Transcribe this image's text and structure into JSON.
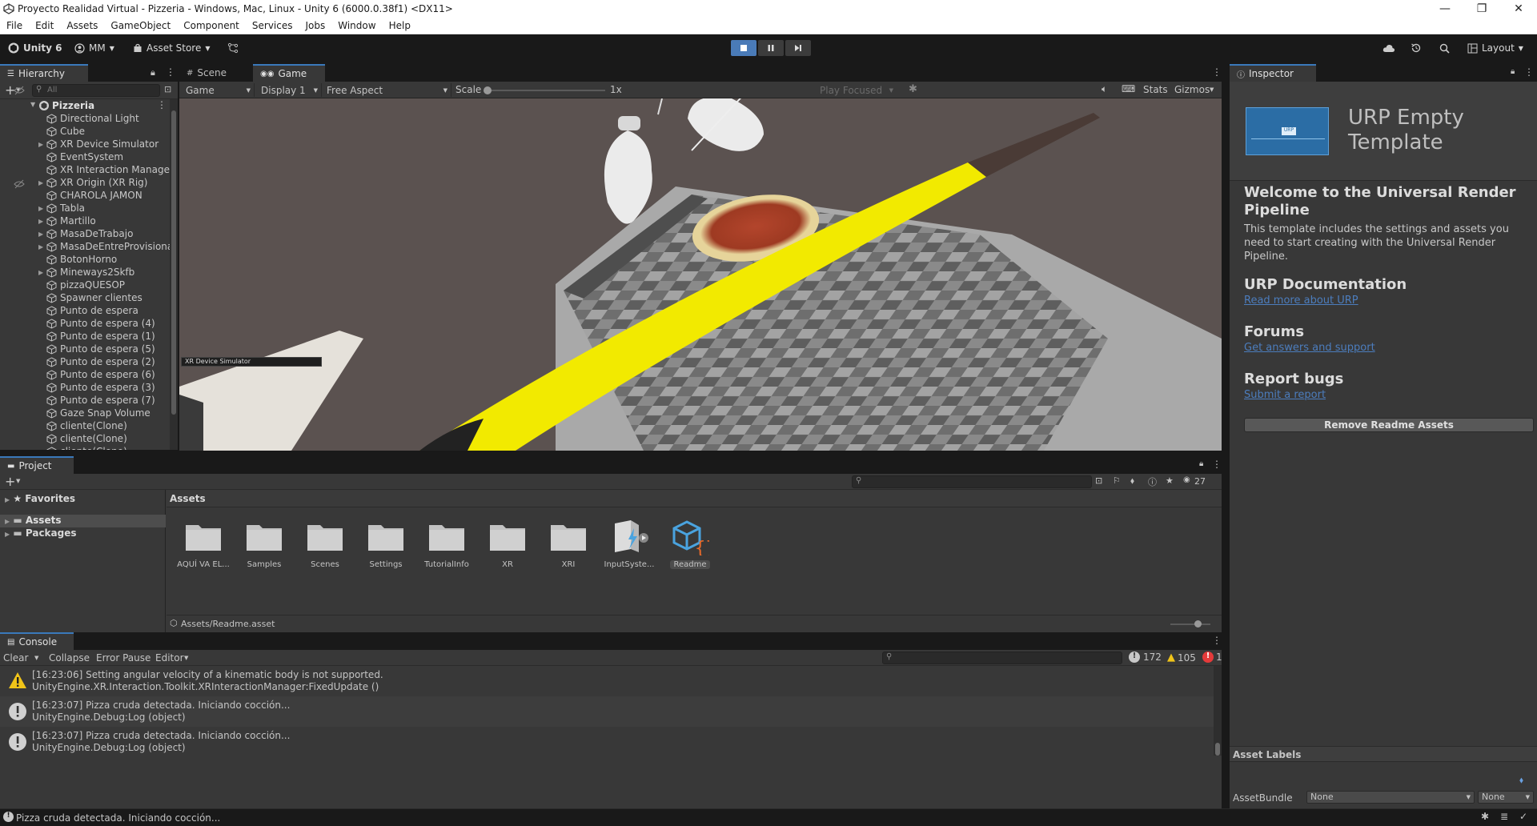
{
  "window": {
    "title": "Proyecto Realidad Virtual - Pizzeria - Windows, Mac, Linux - Unity 6 (6000.0.38f1) <DX11>",
    "minimize": "—",
    "maximize": "❐",
    "close": "✕"
  },
  "menu": [
    "File",
    "Edit",
    "Assets",
    "GameObject",
    "Component",
    "Services",
    "Jobs",
    "Window",
    "Help"
  ],
  "toolbar": {
    "unity_label": "Unity 6",
    "account_label": "MM",
    "asset_store_label": "Asset Store",
    "layout_label": "Layout"
  },
  "hierarchy": {
    "tab_label": "Hierarchy",
    "search_placeholder": "All",
    "scene_name": "Pizzeria",
    "items": [
      {
        "label": "Directional Light",
        "foldable": false
      },
      {
        "label": "Cube",
        "foldable": false
      },
      {
        "label": "XR Device Simulator",
        "foldable": true
      },
      {
        "label": "EventSystem",
        "foldable": false
      },
      {
        "label": "XR Interaction Manager",
        "foldable": false
      },
      {
        "label": "XR Origin (XR Rig)",
        "foldable": true
      },
      {
        "label": "CHAROLA JAMON",
        "foldable": false
      },
      {
        "label": "Tabla",
        "foldable": true
      },
      {
        "label": "Martillo",
        "foldable": true
      },
      {
        "label": "MasaDeTrabajo",
        "foldable": true
      },
      {
        "label": "MasaDeEntreProvisional",
        "foldable": true
      },
      {
        "label": "BotonHorno",
        "foldable": false
      },
      {
        "label": "Mineways2Skfb",
        "foldable": true
      },
      {
        "label": "pizzaQUESOP",
        "foldable": false
      },
      {
        "label": "Spawner clientes",
        "foldable": false
      },
      {
        "label": "Punto de espera",
        "foldable": false
      },
      {
        "label": "Punto de espera (4)",
        "foldable": false
      },
      {
        "label": "Punto de espera (1)",
        "foldable": false
      },
      {
        "label": "Punto de espera (5)",
        "foldable": false
      },
      {
        "label": "Punto de espera (2)",
        "foldable": false
      },
      {
        "label": "Punto de espera (6)",
        "foldable": false
      },
      {
        "label": "Punto de espera (3)",
        "foldable": false
      },
      {
        "label": "Punto de espera (7)",
        "foldable": false
      },
      {
        "label": "Gaze Snap Volume",
        "foldable": false
      },
      {
        "label": "cliente(Clone)",
        "foldable": false
      },
      {
        "label": "cliente(Clone)",
        "foldable": false
      },
      {
        "label": "cliente(Clone)",
        "foldable": false
      }
    ]
  },
  "game_view": {
    "tabs": [
      "Scene",
      "Game"
    ],
    "game_dropdown": "Game",
    "display_dropdown": "Display 1",
    "aspect_dropdown": "Free Aspect",
    "scale_label": "Scale",
    "scale_value": "1x",
    "play_focused": "Play Focused",
    "stats_label": "Stats",
    "gizmos_label": "Gizmos",
    "overlay_label": "XR Device Simulator"
  },
  "project": {
    "tab_label": "Project",
    "badge_count": "27",
    "favorites_label": "Favorites",
    "tree": [
      "Assets",
      "Packages"
    ],
    "breadcrumb": "Assets",
    "assets": [
      {
        "label": "AQUÍ VA EL...",
        "kind": "folder"
      },
      {
        "label": "Samples",
        "kind": "folder"
      },
      {
        "label": "Scenes",
        "kind": "folder"
      },
      {
        "label": "Settings",
        "kind": "folder"
      },
      {
        "label": "TutorialInfo",
        "kind": "folder"
      },
      {
        "label": "XR",
        "kind": "folder"
      },
      {
        "label": "XRI",
        "kind": "folder"
      },
      {
        "label": "InputSyste...",
        "kind": "input-actions"
      },
      {
        "label": "Readme",
        "kind": "readme"
      }
    ],
    "status_path": "Assets/Readme.asset"
  },
  "console": {
    "tab_label": "Console",
    "clear_label": "Clear",
    "collapse_label": "Collapse",
    "error_pause_label": "Error Pause",
    "editor_label": "Editor",
    "info_count": "172",
    "warning_count": "105",
    "error_count": "1",
    "logs": [
      {
        "type": "warning",
        "line1": "[16:23:06] Setting angular velocity of a kinematic body is not supported.",
        "line2": "UnityEngine.XR.Interaction.Toolkit.XRInteractionManager:FixedUpdate ()"
      },
      {
        "type": "info",
        "line1": "[16:23:07] Pizza cruda detectada. Iniciando cocción...",
        "line2": "UnityEngine.Debug:Log (object)"
      },
      {
        "type": "info",
        "line1": "[16:23:07] Pizza cruda detectada. Iniciando cocción...",
        "line2": "UnityEngine.Debug:Log (object)"
      }
    ]
  },
  "inspector": {
    "tab_label": "Inspector",
    "template_title": "URP Empty Template",
    "thumb_label": "URP",
    "welcome_heading": "Welcome to the Universal Render Pipeline",
    "welcome_text": "This template includes the settings and assets you need to start creating with the Universal Render Pipeline.",
    "doc_heading": "URP Documentation",
    "doc_link": "Read more about URP",
    "forums_heading": "Forums",
    "forums_link": "Get answers and support",
    "bugs_heading": "Report bugs",
    "bugs_link": "Submit a report",
    "remove_button": "Remove Readme Assets",
    "asset_labels": "Asset Labels",
    "assetbundle_label": "AssetBundle",
    "assetbundle_value": "None",
    "variant_value": "None"
  },
  "status_bar": {
    "message": "Pizza cruda detectada. Iniciando cocción..."
  },
  "colors": {
    "accent": "#3a79bb",
    "link": "#4c7dbd",
    "warning": "#f0c419",
    "error": "#e53a3a",
    "bat": "#f2ea00"
  }
}
